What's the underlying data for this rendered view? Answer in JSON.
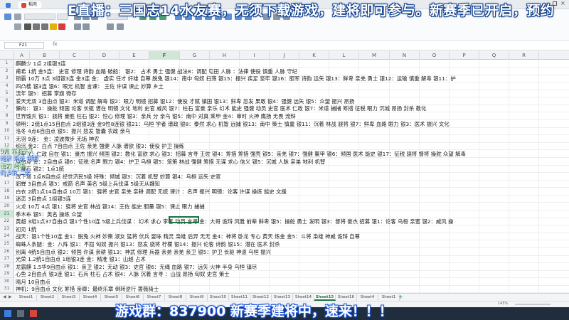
{
  "overlay": {
    "top_banner": "E直播：三国志14水友赛，无须下载游戏，建将即可参与。新赛季已开启，预约",
    "bottom_banner": "游戏群：837900  新赛季建将中，速来！！！",
    "side_note": [
      "9月 左右天人",
      "经济 系统 初期",
      "能力 结束",
      "约 5第 二天"
    ]
  },
  "window": {
    "tab_label": "稻壳",
    "cell_ref": "F21",
    "fx_label": "fx",
    "zoom": "145%"
  },
  "columns": [
    "A",
    "B",
    "C",
    "D",
    "E",
    "F",
    "G",
    "H",
    "I",
    "J",
    "K",
    "L",
    "M",
    "N",
    "O",
    "P",
    "Q",
    "R"
  ],
  "selected_column": "F",
  "rows": [
    {
      "n": "1",
      "text": "麒麟少 1点 2组银3连"
    },
    {
      "n": "2",
      "text": "甫希 1统 金5连： 史官 修理 诗韵 血路 破船：  银2： 占术 勇士 强健 战法8：调配 屯田 人脉 ：法律 使役 慎重 人脉 守纪"
    },
    {
      "n": "3",
      "text": "锁霸 10万 3点 3组银3连 金3连 金： 虚实 任才 奸雄 自尊 脱兔 银14：南中 匈奴 扫荡 银15：振兴 疾足 坚牢 银16：胆军 诗韵 远矢 银13：鲜卑 亲羌 勇士 银12：运输 慎重 解毒 银11：护"
    },
    {
      "n": "4",
      "text": "四凸楼  银3连 银6：眼光 机智 言谏： 王佐 许谋 谏止 妙算 乡土"
    },
    {
      "n": "5",
      "text": "流年 银5：招募 掌旗 微存"
    },
    {
      "n": "6",
      "text": "爱天无双 3自由点 银3：米道 调配 解毒 银2：眼力 明镜 招募 银12：使役 才赋 镇国 银13：鲜卑 忽发 果敢 银4：强健 远矢 银5：众望 振兴 昂扬"
    },
    {
      "n": "7",
      "text": "懈肉： 银1：操舵 倾国 论客 长驱 谱在 明镜 文化 地利 史官 威风 银7：柱石 富豪 亲乐 幻术 能史 强健 动员 史官 医术 仁政 银7：米道 捕捕 筹措 征税 眼力 沉城 昂扬 封杀 教化"
    },
    {
      "n": "8",
      "text": "世界毁灭 银1：骁将 豪胜 柱石 银2：恒心 修理 银3：亲兵 分 亲乌 银5：南中 对真 乘甲 金4：审时 火神 鹰扬 无畏 流辩"
    },
    {
      "n": "9",
      "text": "顿明：2统1点15自由点 2组银3连 金9性8连银 银21：乌桓 学者 谱政 银8：泰然 求心 机智 远捕 银13：南中 策士 慎重 银11：沉着 林战 骁将 银7：鲜卑 血路 眼力 银3：医术 振兴 文化"
    },
    {
      "n": "10",
      "text": "洛冬 4点6自由点 银5：振兴 怒发 智囊 农政 亲乌"
    },
    {
      "n": "11",
      "text": "无羽 9连： 金：凌波微步 无垢 神农"
    },
    {
      "n": "12",
      "text": "纷沉 金2：白点 7自由点 王佐 亲羌 强健 人脉 谱欲 银3：使役 护卫 操练"
    },
    {
      "n": "13",
      "text": "少年 7：仁政 自在 银1：豪杰 振兴 倾国 银2：教化 富欲 求心 银3：招募 言寻 王佐 银4：筹措 筹措 强壳 银5：亲羌 银7：强健 鳌甲 银6：倾国 医术 能史 银17：征税 骁将 督将 操舵 众望 解毒"
    },
    {
      "n": "14",
      "text": "自由点 金：2自由点 银6：征税 名声 眼力 银4：护卫 乌桓 银5：笼策 林战 强健 筹措 无谋 求心 信义 银5：沉城 人脉 亲弟 地利 机智"
    },
    {
      "n": "15",
      "text": "丁罐石 银2：1点1统"
    },
    {
      "n": "16",
      "text": "改下塔 1点8自由点 经世济民5级 特殊：倾城 银3：沉着 机智 妙算 银4：乌桓 远矢 史官"
    },
    {
      "n": "17",
      "text": "貂蝉 3自由点 银3：戒箭 名声 英名 5级上兵伐谋 5级无从魏知"
    },
    {
      "n": "18",
      "text": "白衣 2统1点14自由点 10万 银1：骁将 史官 亲羌 亲耕 调配 无统 谏计 ：名声 振兴 明镜：论客 许谋 操练 能史 文援"
    },
    {
      "n": "19",
      "text": "迷恋 3自由点 1组银3连"
    },
    {
      "n": "20",
      "text": "火龙 10万 4点 银1：骁将 史官 林战 银14：王佐 能史 胆量 银5：谏止 眼力 捕捕"
    },
    {
      "n": "21",
      "text": "季木布 银5：英名 操练 众望"
    },
    {
      "n": "22",
      "text": "黄超 3组1点37自由点 银1个性10连 5级上兵伐谋 ：幻术 求心 李者 动员 言寻 金：大哥 诡辩 风雅 前辈 鲜卑 银5：操舵 勇士 发明 银3：督将 豪杰 招募 银1：论客 乌桓 亲蜜 银2：威风 操"
    },
    {
      "n": "23",
      "text": "初见 1统"
    },
    {
      "n": "24",
      "text": "战天：银1个性10连 金1：脱兔 火神 妙策 淑女 猛将 伏兵 婴咏 精灵 枭雄 后羿 无无 金4：神将 卧龙 专心 黄天 炼金 金5：斗将 枭雄 神威 诡辩 自尊"
    },
    {
      "n": "25",
      "text": "蜘蛛人条腿：金：八阵 银1：不屈 匈奴 振兴 银13：怒发 骁将 柠檬 银14：振兴 论客 诗韵 银15：潜在 医术 封杀"
    },
    {
      "n": "26",
      "text": "别离 4统5自由点 银2：倾国 许谋 亲耕 银13：神武 修理 兵器 亲弟 亲羌 亲卫 银5：护卫 长驱 神速 乌桓 振兴"
    },
    {
      "n": "27",
      "text": "光荣 1.2统1自由点 1组银3连 金：精准 银1：山越 占术"
    },
    {
      "n": "28",
      "text": "龙霸麒 1.5华9自由点 银1：亲卫 银2：无动 银3：史官 银6：无绳 血路 银7：远矢 火神 半身 乌桓 镇尽"
    },
    {
      "n": "29",
      "text": "心鱼 2自由点 银3连 银1：石兵 柱石 占术 银4：人脉 沉着 言寻 ：山战 昂扬 匈奴 史官 策士"
    },
    {
      "n": "30",
      "text": "晴月 10自由点"
    },
    {
      "n": "31",
      "text": "神机：9自由点 文化 筹措 亲卿：最终乐章 倒转逆行 蔷薇骑士"
    }
  ],
  "sheets": [
    "Sheet1",
    "Sheet2",
    "Sheet3",
    "Sheet4",
    "Sheet5",
    "Sheet6",
    "Sheet7",
    "Sheet8",
    "Sheet9",
    "Sheet10",
    "Sheet11",
    "Sheet12",
    "Sheet13",
    "Sheet14",
    "Sheet15",
    "Sheet16",
    "Sheet4",
    "Sheet1"
  ],
  "active_sheet_index": 14,
  "colors": {
    "accent": "#217346",
    "banner_outline": "#1a55d6"
  }
}
